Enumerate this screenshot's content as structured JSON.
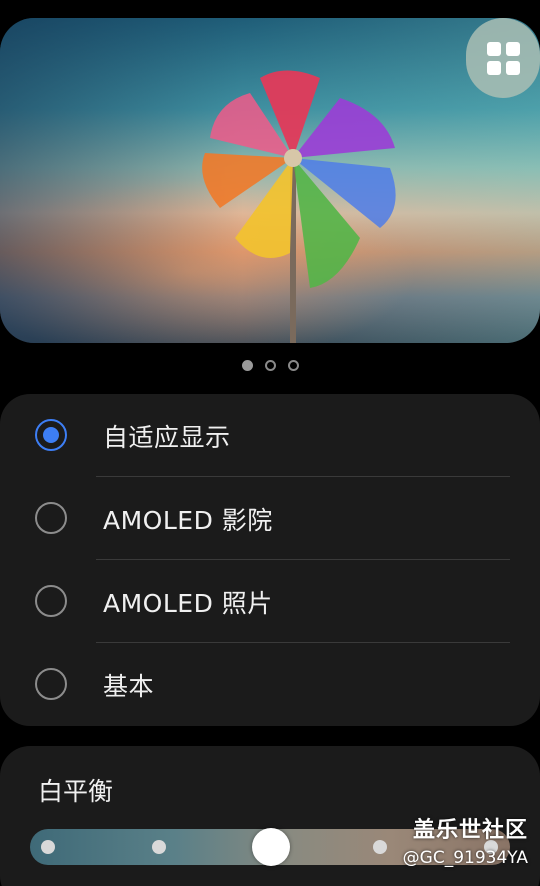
{
  "preview": {
    "image_subject": "rainbow pinwheel against sky",
    "grid_button_icon": "grid-icon",
    "pager": {
      "count": 3,
      "active_index": 0
    }
  },
  "screen_mode": {
    "selected_index": 0,
    "options": [
      {
        "label": "自适应显示",
        "selected": true
      },
      {
        "label": "AMOLED 影院",
        "selected": false
      },
      {
        "label": "AMOLED 照片",
        "selected": false
      },
      {
        "label": "基本",
        "selected": false
      }
    ]
  },
  "white_balance": {
    "title": "白平衡",
    "steps": 5,
    "value_index": 2
  },
  "watermark": {
    "title": "盖乐世社区",
    "handle": "@GC_91934YA"
  },
  "colors": {
    "accent": "#3d7ef4",
    "card_bg": "#1b1b1b",
    "page_bg": "#000000"
  }
}
